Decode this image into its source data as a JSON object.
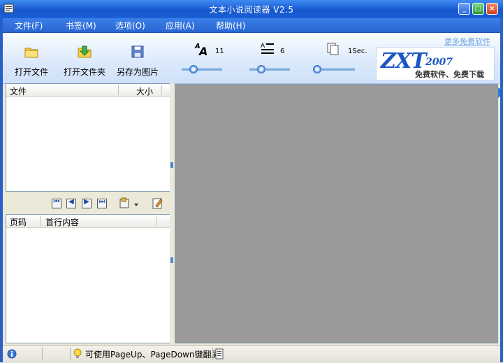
{
  "window": {
    "title": "文本小说阅读器 V2.5",
    "controls": {
      "minimize": "_",
      "maximize": "□",
      "close": "×"
    }
  },
  "menu": [
    {
      "label": "文件(F)"
    },
    {
      "label": "书签(M)"
    },
    {
      "label": "选项(O)"
    },
    {
      "label": "应用(A)"
    },
    {
      "label": "帮助(H)"
    }
  ],
  "toolbar": {
    "open_file": "打开文件",
    "open_folder": "打开文件夹",
    "save_as_image": "另存为图片",
    "font_size_value": "11",
    "line_spacing_value": "6",
    "page_interval_value": "1Sec.",
    "font_size_level": 0.3,
    "line_spacing_level": 0.3,
    "page_interval_level": 0.1
  },
  "brand": {
    "logo_text": "ZXT",
    "logo_year": "2007",
    "tagline": "免费软件、免费下载",
    "link_text": "更多免费软件"
  },
  "file_list": {
    "columns": [
      "文件",
      "大小"
    ],
    "rows": []
  },
  "bookmark_list": {
    "columns": [
      "页码",
      "首行内容"
    ],
    "rows": []
  },
  "nav_icons": [
    "first-page-icon",
    "prev-page-icon",
    "next-page-icon",
    "last-page-icon",
    "bookmark-tools-icon",
    "edit-icon"
  ],
  "status": {
    "hint": "可使用PageUp、PageDown键翻屏"
  },
  "colors": {
    "titlebar": "#1f63d8",
    "content_bg": "#9a9a9a",
    "accent": "#1b56c6"
  }
}
